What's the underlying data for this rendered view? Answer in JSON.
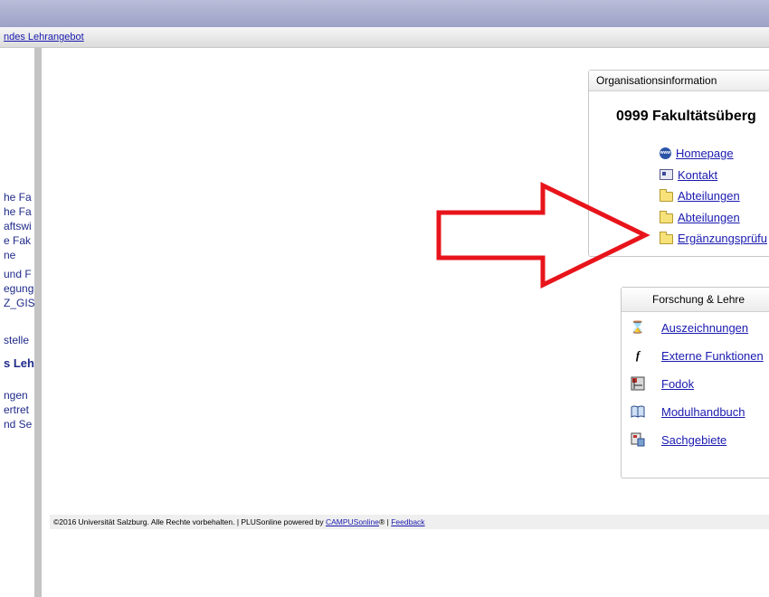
{
  "breadcrumb": "ndes Lehrangebot",
  "left_fragments": [
    {
      "text": "he Fa"
    },
    {
      "text": "he Fa"
    },
    {
      "text": "aftswi"
    },
    {
      "text": "e Fak"
    },
    {
      "text": "ne"
    },
    {
      "text": "und F"
    },
    {
      "text": "egung"
    },
    {
      "text": "Z_GIS"
    },
    {
      "text": "stelle"
    },
    {
      "text": "s Leh"
    },
    {
      "text": "ngen"
    },
    {
      "text": "ertret"
    },
    {
      "text": "nd Se"
    }
  ],
  "org_panel": {
    "title": "Organisationsinformation",
    "org_name": "0999  Fakultätsüberg",
    "links": [
      {
        "label": "Homepage",
        "icon": "www-globe-icon"
      },
      {
        "label": "Kontakt",
        "icon": "contact-card-icon"
      },
      {
        "label": "Abteilungen",
        "icon": "folder-icon"
      },
      {
        "label": "Abteilungen",
        "icon": "folder-icon"
      },
      {
        "label": "Ergänzungsprüfu",
        "icon": "folder-icon"
      }
    ]
  },
  "research_panel": {
    "title": "Forschung & Lehre",
    "items": [
      {
        "label": "Auszeichnungen",
        "icon": "trophy-icon"
      },
      {
        "label": "Externe Funktionen",
        "icon": "function-icon"
      },
      {
        "label": "Fodok",
        "icon": "fodok-icon"
      },
      {
        "label": "Modulhandbuch",
        "icon": "book-icon"
      },
      {
        "label": "Sachgebiete",
        "icon": "subject-areas-icon"
      }
    ]
  },
  "footer": {
    "copyright": "©2016 Universität Salzburg. Alle Rechte vorbehalten. | PLUSonline powered by ",
    "campus_link": "CAMPUSonline",
    "registered": "® | ",
    "feedback_link": "Feedback"
  },
  "colors": {
    "link": "#1a1ab0",
    "arrow": "#e8141b",
    "header_bar": "#a8acd0"
  }
}
